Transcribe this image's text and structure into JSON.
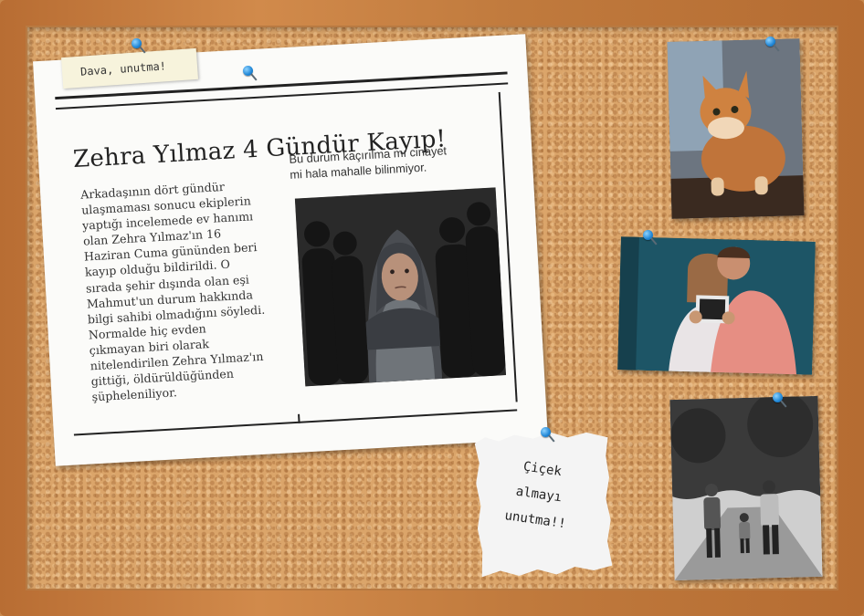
{
  "sticky_note": {
    "text": "Dava, unutma!"
  },
  "newspaper": {
    "headline": "Zehra Yılmaz 4 Gündür Kayıp!",
    "column1": [
      "Arkadaşının dört gündür",
      "ulaşmaması sonucu ekiplerin",
      "yaptığı incelemede ev hanımı",
      "olan Zehra Yılmaz'ın 16",
      "Haziran Cuma gününden beri",
      "kayıp olduğu bildirildi. O",
      "sırada şehir dışında olan eşi",
      "Mahmut'un durum hakkında",
      "bilgi sahibi olmadığını söyledi.",
      "Normalde hiç evden",
      "çıkmayan biri olarak",
      "nitelendirilen Zehra Yılmaz'ın",
      "gittiği, öldürüldüğünden",
      "şüpheleniliyor."
    ],
    "column2": [
      "Bu durum kaçırılma mı cinayet",
      "mi hala mahalle bilinmiyor."
    ]
  },
  "torn_note": {
    "lines": [
      "Çiçek",
      "almayı",
      "unutma!!"
    ]
  },
  "colors": {
    "pin": "#1f86d6",
    "cork": "#dba56a",
    "frame": "#c07a3d"
  }
}
